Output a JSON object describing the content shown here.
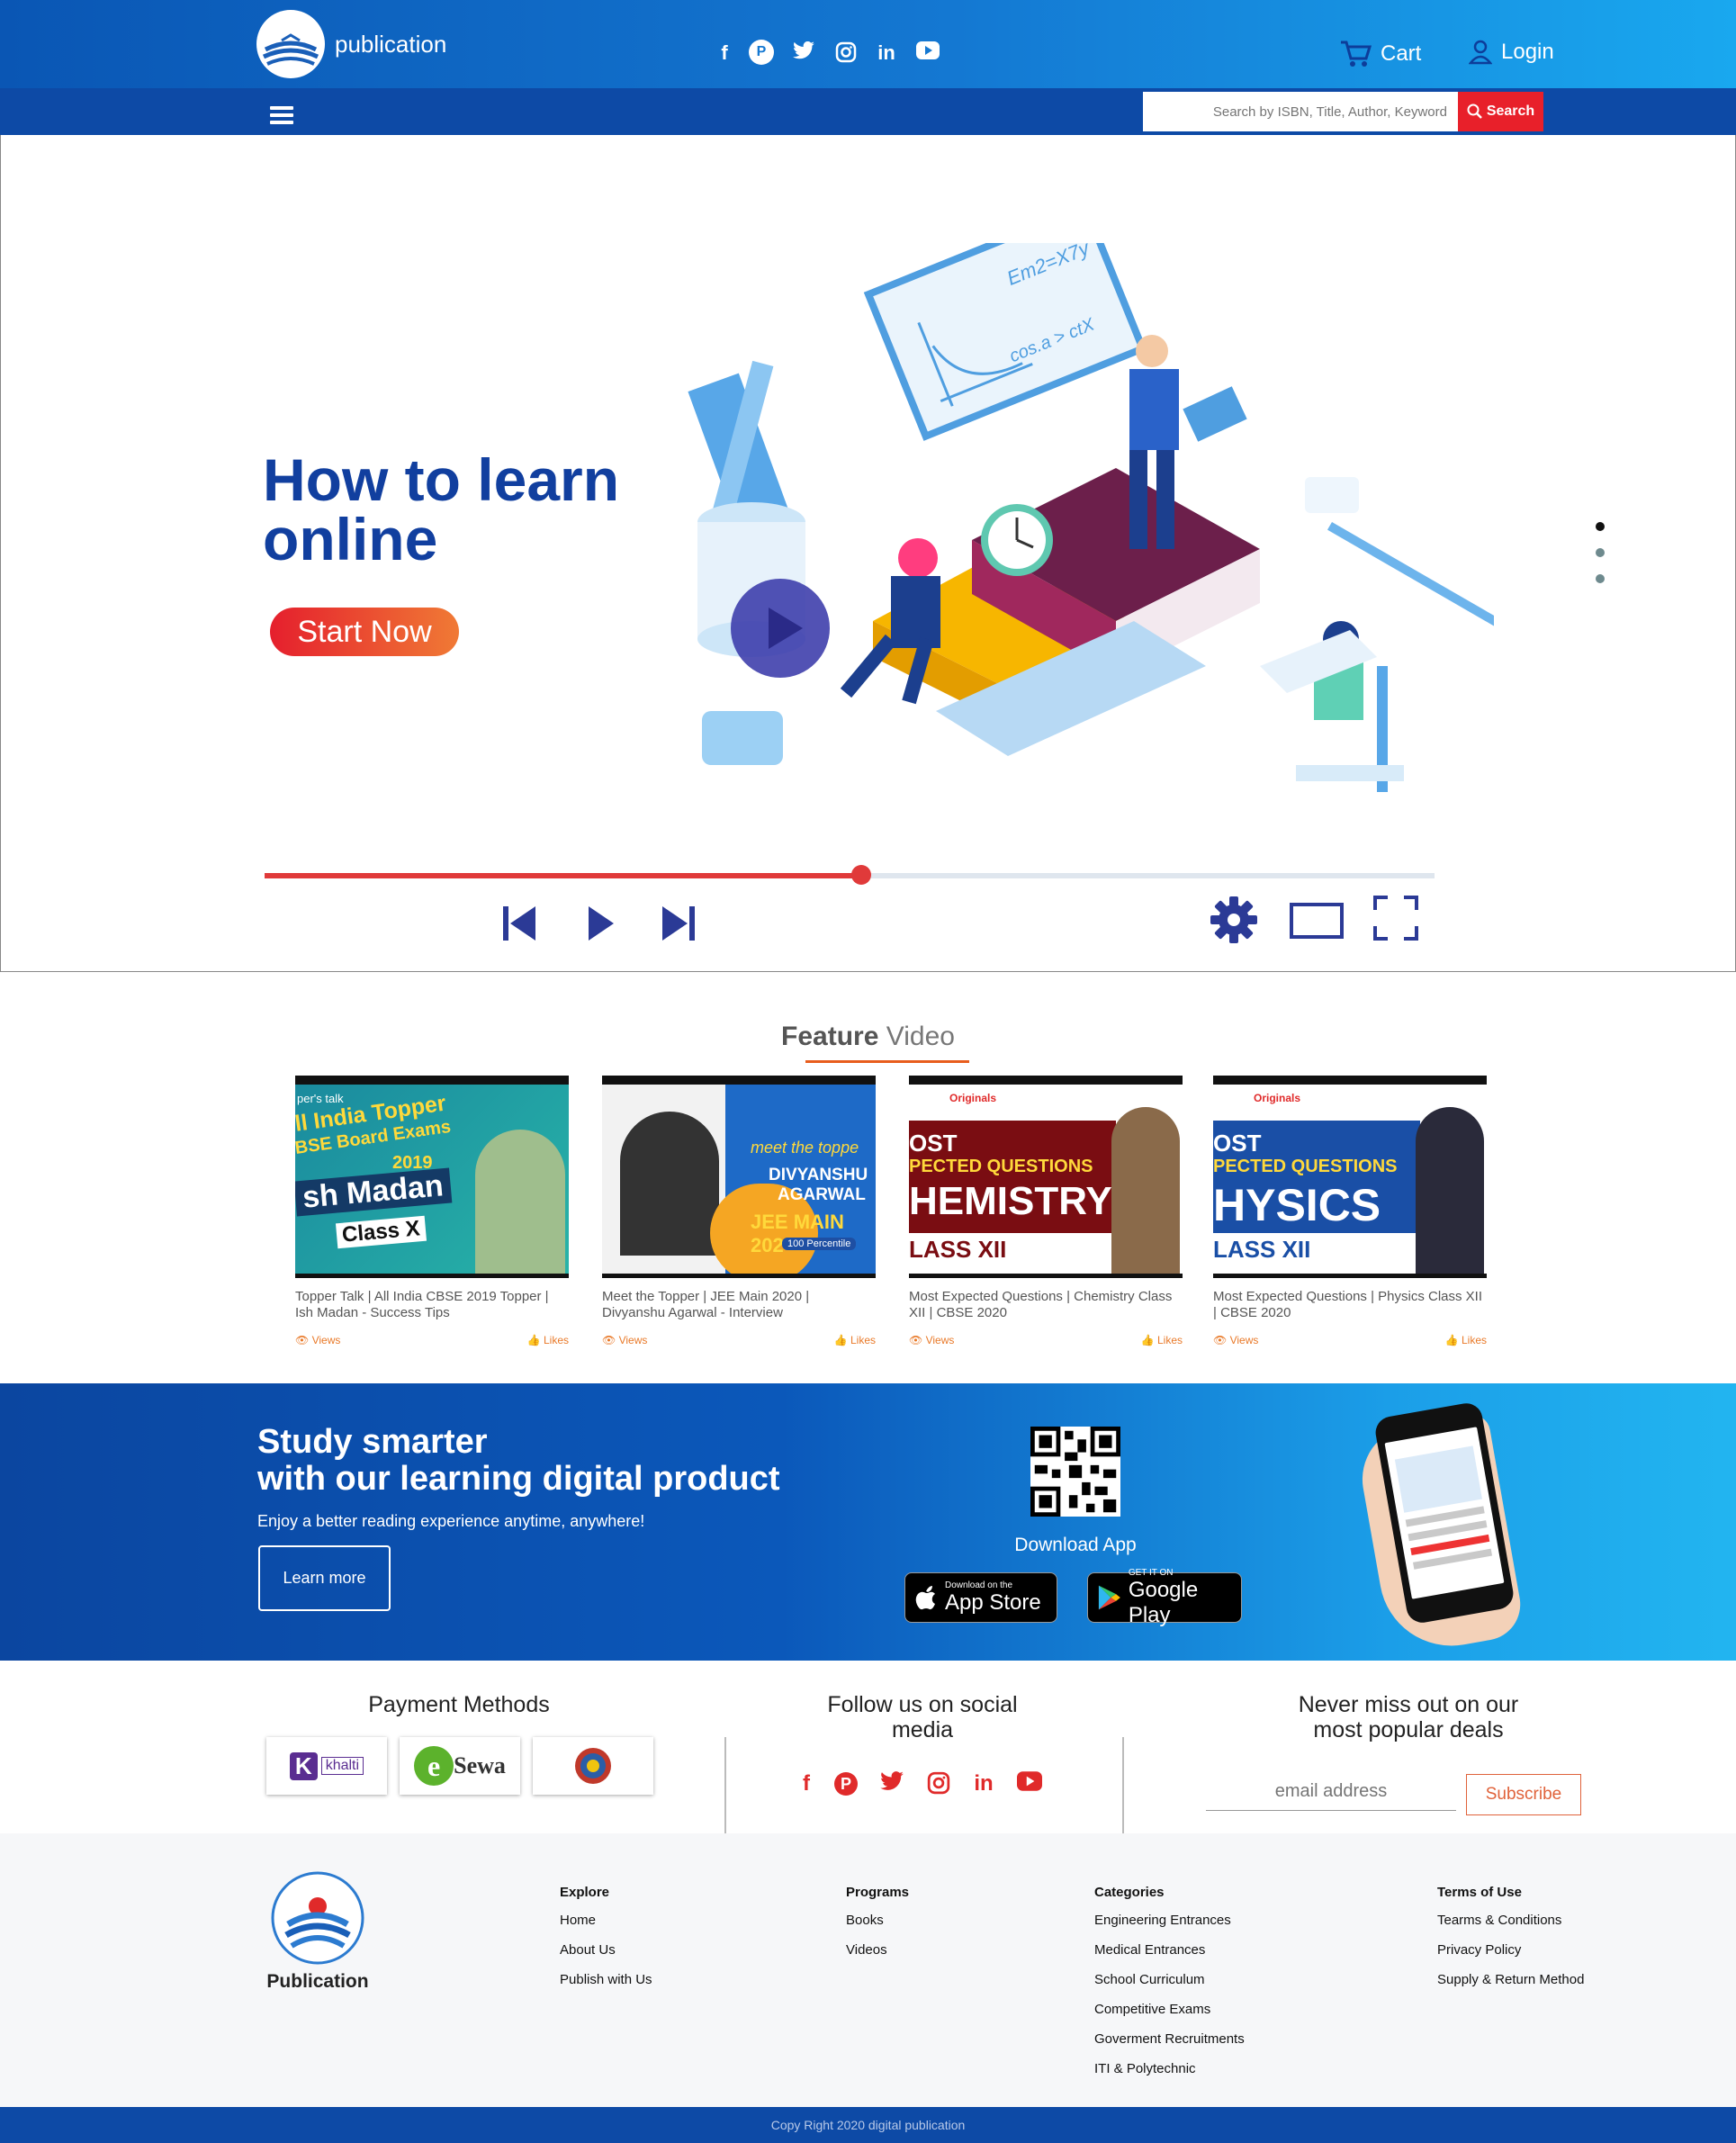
{
  "header": {
    "brand": "publication",
    "social": [
      {
        "icon": "facebook-icon",
        "glyph": "f"
      },
      {
        "icon": "pinterest-icon",
        "glyph": "P"
      },
      {
        "icon": "twitter-icon",
        "glyph": "t"
      },
      {
        "icon": "instagram-icon",
        "glyph": "◎"
      },
      {
        "icon": "linkedin-icon",
        "glyph": "in"
      },
      {
        "icon": "youtube-icon",
        "glyph": "▶"
      }
    ],
    "cart_label": "Cart",
    "login_label": "Login"
  },
  "navbar": {
    "search_placeholder": "Search by ISBN, Title, Author, Keyword",
    "search_button": "Search"
  },
  "hero": {
    "title_line1": "How to learn",
    "title_line2": "online",
    "cta": "Start Now",
    "progress": 0.51,
    "formula1": "Em2=X7y",
    "formula2": "cos.a > ctX"
  },
  "features": {
    "title_bold": "Feature",
    "title_rest": " Video",
    "videos": [
      {
        "title": "Topper Talk | All India CBSE 2019 Topper | Ish Madan - Success Tips",
        "views": "Views",
        "likes": "Likes",
        "thumb_lines": [
          "per's talk",
          "ll India Topper",
          "BSE Board Exams",
          "2019",
          "sh Madan",
          "Class X"
        ]
      },
      {
        "title": "Meet the Topper | JEE Main 2020 | Divyanshu Agarwal - Interview",
        "views": "Views",
        "likes": "Likes",
        "thumb_lines": [
          "meet the toppe",
          "DIVYANSHU",
          "AGARWAL",
          "JEE MAIN 202",
          "100 Percentile"
        ]
      },
      {
        "title": "Most Expected Questions | Chemistry Class XII | CBSE 2020",
        "views": "Views",
        "likes": "Likes",
        "thumb_lines": [
          "Originals",
          "OST",
          "PECTED QUESTIONS",
          "HEMISTRY",
          "LASS XII"
        ]
      },
      {
        "title": "Most Expected Questions | Physics Class XII | CBSE 2020",
        "views": "Views",
        "likes": "Likes",
        "thumb_lines": [
          "Originals",
          "OST",
          "PECTED QUESTIONS",
          "HYSICS",
          "LASS XII"
        ]
      }
    ]
  },
  "promo": {
    "heading_line1": "Study smarter",
    "heading_line2": "with our learning digital product",
    "subtitle": "Enjoy a better reading  experience anytime, anywhere!",
    "learn_more": "Learn more",
    "download_label": "Download App",
    "appstore_small": "Download on the",
    "appstore_big": "App Store",
    "googleplay_small": "GET IT ON",
    "googleplay_big": "Google Play"
  },
  "payment": {
    "title": "Payment Methods",
    "methods": [
      "khalti",
      "Sewa"
    ]
  },
  "follow": {
    "title_line1": "Follow us on social",
    "title_line2": "media"
  },
  "newsletter": {
    "title_line1": "Never miss out on our",
    "title_line2": "most popular deals",
    "email_placeholder": "email address",
    "subscribe": "Subscribe"
  },
  "footer": {
    "brand": "Publication",
    "columns": [
      {
        "heading": "Explore",
        "links": [
          "Home",
          "About Us",
          "Publish with Us"
        ]
      },
      {
        "heading": "Programs",
        "links": [
          "Books",
          "Videos"
        ]
      },
      {
        "heading": "Categories",
        "links": [
          "Engineering Entrances",
          "Medical Entrances",
          "School Curriculum",
          "Competitive Exams",
          "Goverment Recruitments",
          "ITI & Polytechnic"
        ]
      },
      {
        "heading": "Terms of Use",
        "links": [
          "Tearms & Conditions",
          "Privacy Policy",
          "Supply & Return Method"
        ]
      }
    ],
    "copyright": "Copy Right 2020 digital publication"
  },
  "colors": {
    "primary": "#0d4aa6",
    "accent": "#e8202a",
    "hero_title": "#113f9f",
    "orange": "#e85d1d"
  }
}
